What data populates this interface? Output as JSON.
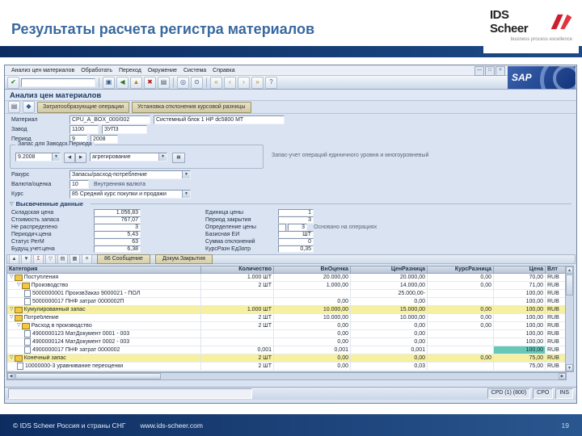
{
  "slide": {
    "title": "Результаты расчета регистра материалов",
    "footer_left": "© IDS Scheer Россия и страны СНГ",
    "footer_url": "www.ids-scheer.com",
    "page_number": "19"
  },
  "logo": {
    "name": "IDS Scheer",
    "tagline": "business process excellence"
  },
  "sap": {
    "logo_text": "SAP",
    "title": "Анализ цен материалов",
    "menus": [
      "Анализ цен материалов",
      "Обработать",
      "Переход",
      "Окружение",
      "Система",
      "Справка"
    ],
    "window_icons": [
      {
        "name": "minimize-icon",
        "glyph": "—"
      },
      {
        "name": "restore-icon",
        "glyph": "□"
      },
      {
        "name": "close-icon",
        "glyph": "×"
      }
    ],
    "std_icons": [
      {
        "name": "enter-icon",
        "glyph": "✔",
        "color": "#1c7c1c"
      },
      {
        "name": "save-icon",
        "glyph": "▣",
        "color": "#355a8c"
      },
      {
        "name": "back-icon",
        "glyph": "◀",
        "color": "#2c7a2c"
      },
      {
        "name": "exit-icon",
        "glyph": "▲",
        "color": "#b08818"
      },
      {
        "name": "cancel-icon",
        "glyph": "✖",
        "color": "#b02020"
      },
      {
        "name": "print-icon",
        "glyph": "▤",
        "color": "#44566c"
      },
      {
        "name": "find-icon",
        "glyph": "◎",
        "color": "#355a8c"
      },
      {
        "name": "find-next-icon",
        "glyph": "⊙",
        "color": "#355a8c"
      },
      {
        "name": "first-page-icon",
        "glyph": "«",
        "color": "#b08818"
      },
      {
        "name": "prev-page-icon",
        "glyph": "‹",
        "color": "#b08818"
      },
      {
        "name": "next-page-icon",
        "glyph": "›",
        "color": "#b08818"
      },
      {
        "name": "last-page-icon",
        "glyph": "»",
        "color": "#b08818"
      },
      {
        "name": "help-icon",
        "glyph": "?",
        "color": "#355a8c"
      }
    ],
    "app_icons": [
      {
        "name": "detail-icon",
        "glyph": "▤",
        "color": "#44566c"
      },
      {
        "name": "other-material-icon",
        "glyph": "◆",
        "color": "#355a8c"
      }
    ],
    "app_buttons": [
      "Затратообразующие операции",
      "Установка отклонения курсовой разницы"
    ],
    "icons": {
      "expander": "▽",
      "dropdown": "▼",
      "prev": "◀",
      "next": "▶",
      "grid": "▦"
    },
    "form": {
      "material_label": "Материал",
      "material_value": "CPU_A_BOX_000/002",
      "material_desc": "Системный блок 1 HP dc5800 MT",
      "plant_label": "Завод",
      "plant_value": "1100",
      "plant_desc": "ЗУП3",
      "period_label": "Период",
      "period_value": "9",
      "period_year": "2008",
      "group_title": "Запас для Заводск.Периода",
      "period_combo": "9.2008",
      "aggregation_combo": "агрегирование",
      "group_note": "Запас-учет операций единичного уровня и многоуровневый",
      "view_label": "Ракурс",
      "view_value": "Запасы/расход-потребление",
      "currency_label": "Валюта/оценка",
      "currency_value": "10",
      "currency_desc": "Внутренняя валюта",
      "rate_label": "Курс",
      "rate_value": "85 Средний курс покупки и продажи"
    },
    "details_title": "Высвеченные данные",
    "details_left": [
      {
        "label": "Складская цена",
        "value": "1.056,83"
      },
      {
        "label": "Стоимость запаса",
        "value": "767,07"
      },
      {
        "label": "Не распределено",
        "value": "3"
      },
      {
        "label": "Периодич.цена",
        "value": "5,43"
      },
      {
        "label": "Статус РегМ",
        "value": "63"
      },
      {
        "label": "Будущ.учет.цена",
        "value": "6,38"
      }
    ],
    "details_right": [
      {
        "label": "Единица цены",
        "value": "1"
      },
      {
        "label": "Период закрытия",
        "value": "3"
      },
      {
        "label": "Определение цены",
        "value": "3",
        "note": "Основано на операциях",
        "checkbox": true
      },
      {
        "label": "Базисная ЕИ",
        "value": "ШТ"
      },
      {
        "label": "Сумма отклонений",
        "value": "0"
      },
      {
        "label": "КурсРазн ЕдЗатр",
        "value": "0,35"
      }
    ],
    "table": {
      "icons": [
        {
          "name": "sort-asc-icon",
          "glyph": "▲",
          "color": "#44566c"
        },
        {
          "name": "sort-desc-icon",
          "glyph": "▼",
          "color": "#44566c"
        },
        {
          "name": "sum-icon",
          "glyph": "Σ",
          "color": "#a03030"
        },
        {
          "name": "filter-icon",
          "glyph": "▽",
          "color": "#44566c"
        },
        {
          "name": "print-icon",
          "glyph": "▤",
          "color": "#44566c"
        },
        {
          "name": "export-icon",
          "glyph": "▦",
          "color": "#44566c"
        },
        {
          "name": "layout-icon",
          "glyph": "≡",
          "color": "#44566c"
        }
      ],
      "buttons": [
        "86 Сообщение",
        "Докум.Закрытия"
      ],
      "columns": [
        "Категория",
        "Количество",
        "ВнОценка",
        "ЦенРазница",
        "КурсРазница",
        "Цена",
        "Влт"
      ],
      "rows": [
        {
          "indent": 0,
          "exp": true,
          "icon": "folder",
          "label": "Поступления",
          "qty": "1.000 ШТ",
          "v1": "20.000,00",
          "v2": "20.000,00",
          "v3": "0,00",
          "price": "70,00",
          "curr": "RUB"
        },
        {
          "indent": 1,
          "exp": true,
          "icon": "folder",
          "label": "Производство",
          "qty": "2 ШТ",
          "v1": "1.000,00",
          "v2": "14.000,00",
          "v3": "0,00",
          "price": "71,00",
          "curr": "RUB"
        },
        {
          "indent": 2,
          "exp": false,
          "icon": "doc",
          "label": "5000000001 ПроизвЗаказ 9000021 - ПОЛ",
          "qty": "",
          "v1": "",
          "v2": "25.000,00-",
          "v3": "",
          "price": "100,00",
          "curr": "RUB"
        },
        {
          "indent": 2,
          "exp": false,
          "icon": "doc",
          "label": "5000000017 ПНФ затрат 0000002П",
          "qty": "",
          "v1": "0,00",
          "v2": "0,00",
          "v3": "",
          "price": "100,00",
          "curr": "RUB"
        },
        {
          "indent": 0,
          "exp": true,
          "icon": "folder",
          "label": "Кумулированный запас",
          "qty": "1.000 ШТ",
          "v1": "10.000,00",
          "v2": "15.000,00",
          "v3": "0,00",
          "price": "100,00",
          "curr": "RUB",
          "hl": "yellow"
        },
        {
          "indent": 0,
          "exp": true,
          "icon": "folder",
          "label": "Потребление",
          "qty": "2 ШТ",
          "v1": "10.000,00",
          "v2": "10.000,00",
          "v3": "0,00",
          "price": "100,00",
          "curr": "RUB"
        },
        {
          "indent": 1,
          "exp": true,
          "icon": "folder",
          "label": "Расход в производство",
          "qty": "2 ШТ",
          "v1": "0,00",
          "v2": "0,00",
          "v3": "0,00",
          "price": "100,00",
          "curr": "RUB"
        },
        {
          "indent": 2,
          "exp": false,
          "icon": "doc",
          "label": "4900000123 МатДокумент 0001 - 003",
          "qty": "",
          "v1": "0,00",
          "v2": "0,00",
          "v3": "",
          "price": "100,00",
          "curr": "RUB"
        },
        {
          "indent": 2,
          "exp": false,
          "icon": "doc",
          "label": "4900000124 МатДокумент 0002 - 003",
          "qty": "",
          "v1": "0,00",
          "v2": "0,00",
          "v3": "",
          "price": "100,00",
          "curr": "RUB"
        },
        {
          "indent": 2,
          "exp": false,
          "icon": "doc",
          "label": "4900000017 ПНФ затрат 0000002",
          "qty": "0,001",
          "v1": "0,001",
          "v2": "0,001",
          "v3": "",
          "price": "100,00",
          "curr": "RUB",
          "price_hl": true
        },
        {
          "indent": 0,
          "exp": true,
          "icon": "folder",
          "label": "Конечный запас",
          "qty": "2 ШТ",
          "v1": "0,00",
          "v2": "0,00",
          "v3": "0,00",
          "price": "75,00",
          "curr": "RUB",
          "hl": "yellow"
        },
        {
          "indent": 1,
          "exp": false,
          "icon": "doc",
          "label": "10000000-3 уравнивание переоценки",
          "qty": "2 ШТ",
          "v1": "0,00",
          "v2": "0,03",
          "v3": "",
          "price": "75,00",
          "curr": "RUB"
        }
      ]
    },
    "statusbar": {
      "segments": [
        "CPD (1) (800)",
        "CPO",
        "INS"
      ]
    }
  }
}
